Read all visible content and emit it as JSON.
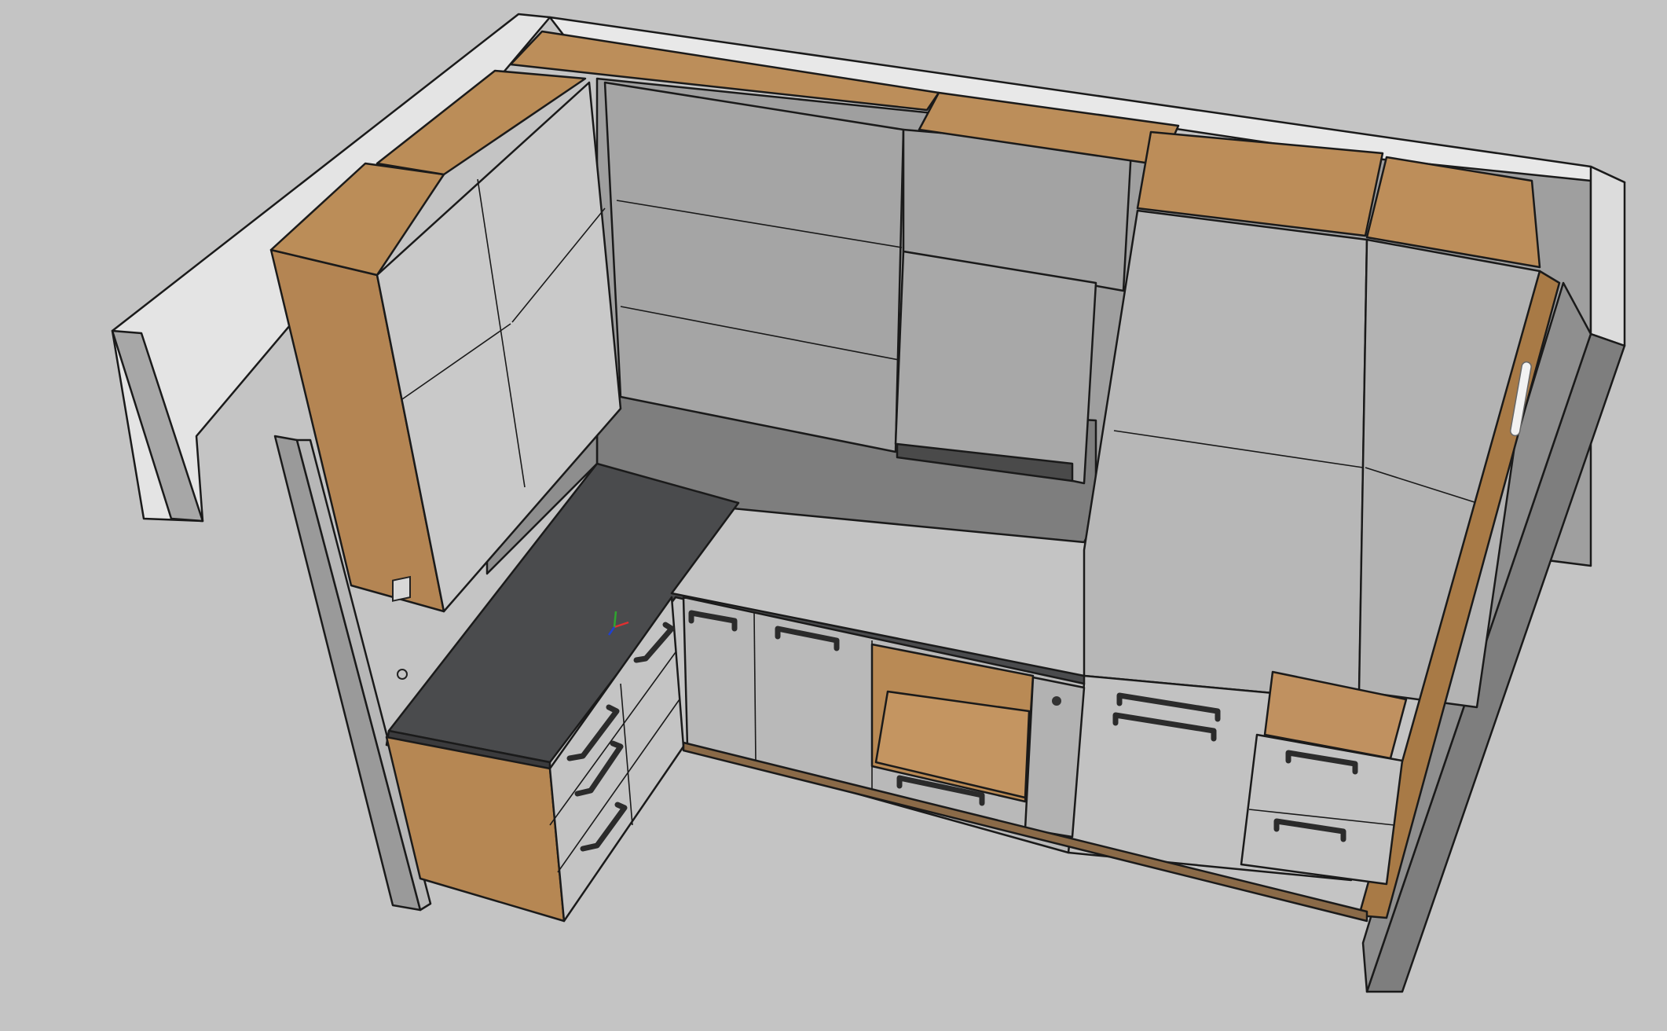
{
  "viewport": {
    "background": "#c4c4c4",
    "model": "kitchen-3d-model",
    "axis_colors": {
      "x": "#e03030",
      "y": "#2fa52f",
      "z": "#2040d0"
    }
  },
  "materials": {
    "wall_top": "#e6e6e6",
    "wall_front": "#a5a5a5",
    "wall_side": "#8a8a8a",
    "cabinet_face": "#b8b8b8",
    "cabinet_face_light": "#c9c9c9",
    "oak": "#b98a55",
    "oak_dark": "#9c6d3e",
    "countertop": "#4a4a4c",
    "backsplash": "#7f7f7f",
    "handle": "#2b2b2b"
  }
}
